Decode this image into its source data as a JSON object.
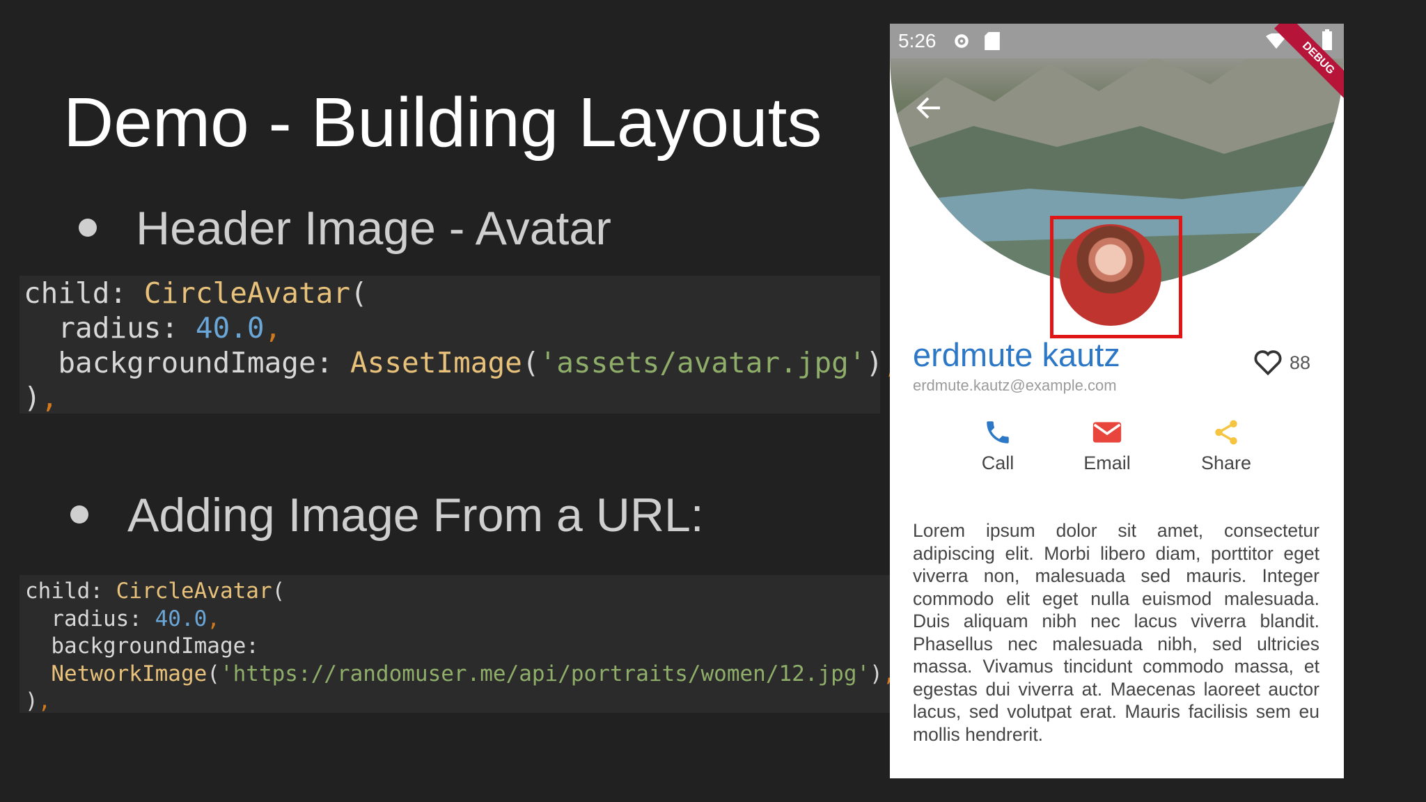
{
  "slide": {
    "title": "Demo - Building Layouts",
    "bullet1": "Header Image - Avatar",
    "bullet2": "Adding Image From a URL:"
  },
  "code_asset": [
    [
      {
        "t": "child: ",
        "c": "plain"
      },
      {
        "t": "CircleAvatar",
        "c": "kw"
      },
      {
        "t": "(",
        "c": "plain"
      }
    ],
    [
      {
        "t": "  radius: ",
        "c": "plain"
      },
      {
        "t": "40.0",
        "c": "num"
      },
      {
        "t": ",",
        "c": "cm"
      }
    ],
    [
      {
        "t": "  backgroundImage: ",
        "c": "plain"
      },
      {
        "t": "AssetImage",
        "c": "kw"
      },
      {
        "t": "(",
        "c": "plain"
      },
      {
        "t": "'assets/avatar.jpg'",
        "c": "str"
      },
      {
        "t": ")",
        "c": "plain"
      },
      {
        "t": ",",
        "c": "cm"
      }
    ],
    [
      {
        "t": ")",
        "c": "plain"
      },
      {
        "t": ",",
        "c": "cm"
      }
    ]
  ],
  "code_network": [
    [
      {
        "t": "child: ",
        "c": "plain"
      },
      {
        "t": "CircleAvatar",
        "c": "kw"
      },
      {
        "t": "(",
        "c": "plain"
      }
    ],
    [
      {
        "t": "  radius: ",
        "c": "plain"
      },
      {
        "t": "40.0",
        "c": "num"
      },
      {
        "t": ",",
        "c": "cm"
      }
    ],
    [
      {
        "t": "  backgroundImage:",
        "c": "plain"
      }
    ],
    [
      {
        "t": "  NetworkImage",
        "c": "kw"
      },
      {
        "t": "(",
        "c": "plain"
      },
      {
        "t": "'https://randomuser.me/api/portraits/women/12.jpg'",
        "c": "str"
      },
      {
        "t": ")",
        "c": "plain"
      },
      {
        "t": ",",
        "c": "cm"
      }
    ],
    [
      {
        "t": ")",
        "c": "plain"
      },
      {
        "t": ",",
        "c": "cm"
      }
    ]
  ],
  "phone": {
    "status_time": "5:26",
    "debug_label": "DEBUG",
    "name": "erdmute kautz",
    "email": "erdmute.kautz@example.com",
    "likes": "88",
    "actions": {
      "call": "Call",
      "email": "Email",
      "share": "Share"
    },
    "body": "Lorem ipsum dolor sit amet, consectetur adipiscing elit. Morbi libero diam, porttitor eget viverra non, malesuada sed mauris. Integer commodo elit eget nulla euismod malesuada. Duis aliquam nibh nec lacus viverra blandit. Phasellus nec malesuada nibh, sed ultricies massa. Vivamus tincidunt commodo massa, et egestas dui viverra at. Maecenas laoreet auctor lacus, sed volutpat erat. Mauris facilisis sem eu mollis hendrerit."
  },
  "colors": {
    "accent": "#2c78c6",
    "highlight": "#e01515",
    "email_icon": "#e8453c",
    "share_icon": "#f5c542"
  }
}
